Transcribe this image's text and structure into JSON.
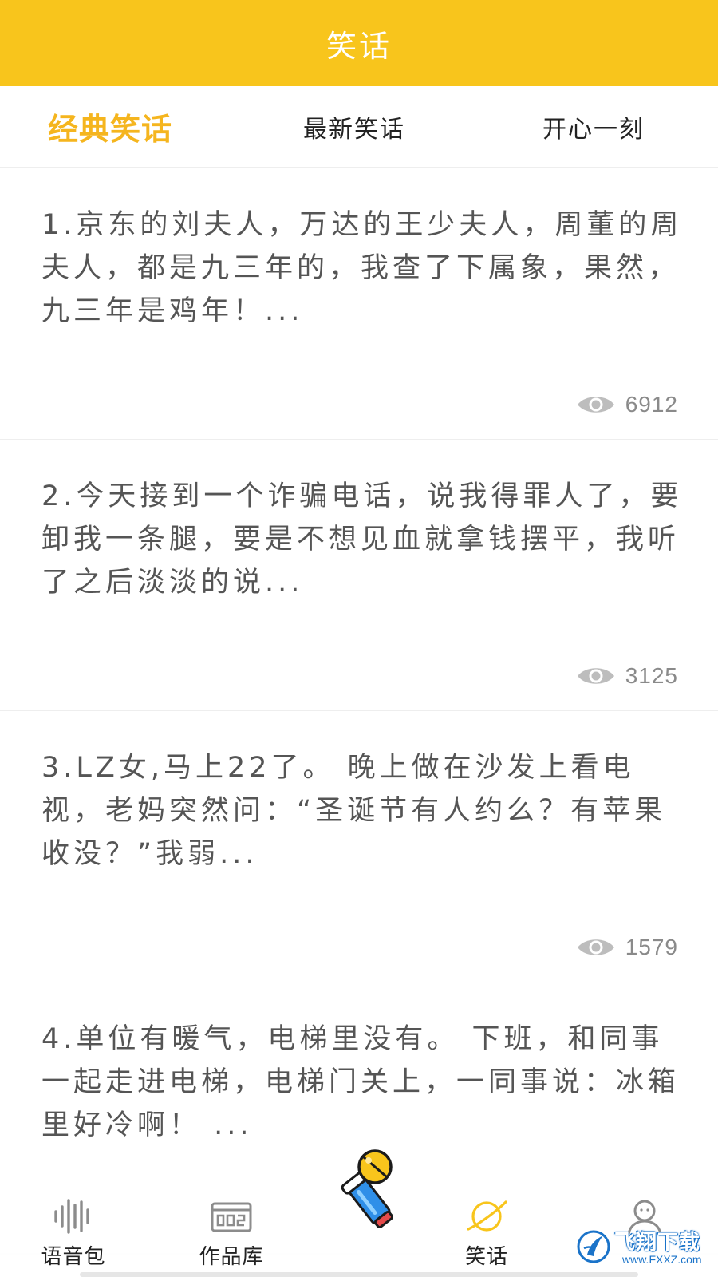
{
  "app_bar": {
    "title": "笑话"
  },
  "tabs": [
    {
      "label": "经典笑话",
      "active": true
    },
    {
      "label": "最新笑话",
      "active": false
    },
    {
      "label": "开心一刻",
      "active": false
    }
  ],
  "jokes": [
    {
      "text": "1.京东的刘夫人，万达的王少夫人，周董的周夫人，都是九三年的，我查了下属象，果然，九三年是鸡年！...",
      "views": "6912"
    },
    {
      "text": "2.今天接到一个诈骗电话，说我得罪人了，要卸我一条腿，要是不想见血就拿钱摆平，我听了之后淡淡的说...",
      "views": "3125"
    },
    {
      "text": "3.LZ女,马上22了。 晚上做在沙发上看电视，老妈突然问：“圣诞节有人约么？有苹果收没？”我弱...",
      "views": "1579"
    },
    {
      "text": "4.单位有暖气，电梯里没有。 下班，和同事一起走进电梯，电梯门关上，一同事说：冰箱里好冷啊！ ...",
      "views": ""
    }
  ],
  "bottom_nav": [
    {
      "label": "语音包",
      "icon": "sound-wave-icon",
      "active": false
    },
    {
      "label": "作品库",
      "icon": "library-icon",
      "active": false
    },
    {
      "label": "笑话",
      "icon": "planet-icon",
      "active": true
    },
    {
      "label": "",
      "icon": "person-icon",
      "active": false
    }
  ],
  "fab": {
    "icon": "microphone-icon"
  },
  "watermark": {
    "title": "飞翔下载",
    "subtitle": "www.FXXZ.com"
  },
  "colors": {
    "accent": "#F8C51C",
    "tab_active": "#F5B51E",
    "text": "#555555",
    "muted": "#8a8a8a"
  }
}
